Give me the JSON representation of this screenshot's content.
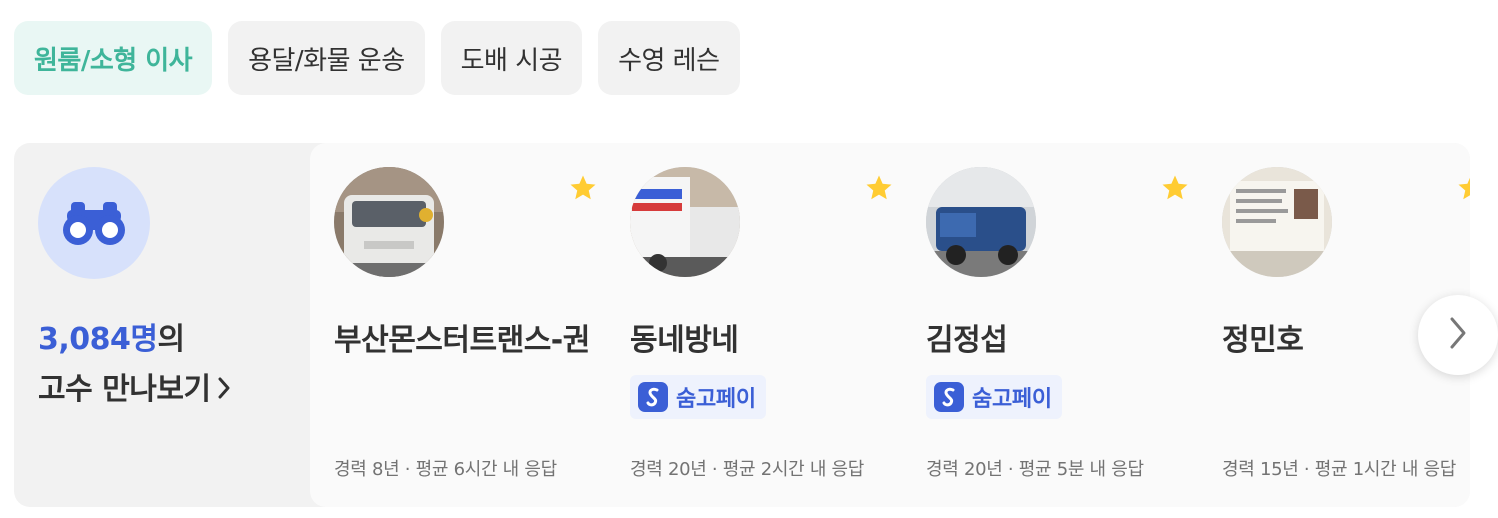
{
  "tabs": [
    {
      "label": "원룸/소형 이사",
      "active": true
    },
    {
      "label": "용달/화물 운송",
      "active": false
    },
    {
      "label": "도배 시공",
      "active": false
    },
    {
      "label": "수영 레슨",
      "active": false
    }
  ],
  "intro": {
    "count": "3,084명",
    "count_suffix": "의",
    "cta": "고수 만나보기",
    "icon": "binoculars-icon"
  },
  "cards": [
    {
      "name": "부산몬스터트랜스-권",
      "pay_badge": false,
      "pay_label": "",
      "career": "경력 8년",
      "response": "평균 6시간 내 응답"
    },
    {
      "name": "동네방네",
      "pay_badge": true,
      "pay_label": "숨고페이",
      "career": "경력 20년",
      "response": "평균 2시간 내 응답"
    },
    {
      "name": "김정섭",
      "pay_badge": true,
      "pay_label": "숨고페이",
      "career": "경력 20년",
      "response": "평균 5분 내 응답"
    },
    {
      "name": "정민호",
      "pay_badge": false,
      "pay_label": "",
      "career": "경력 15년",
      "response": "평균 1시간 내 응답"
    }
  ],
  "colors": {
    "accent_green": "#3fb59a",
    "accent_blue": "#3b5fd6",
    "star": "#ffcc33"
  }
}
